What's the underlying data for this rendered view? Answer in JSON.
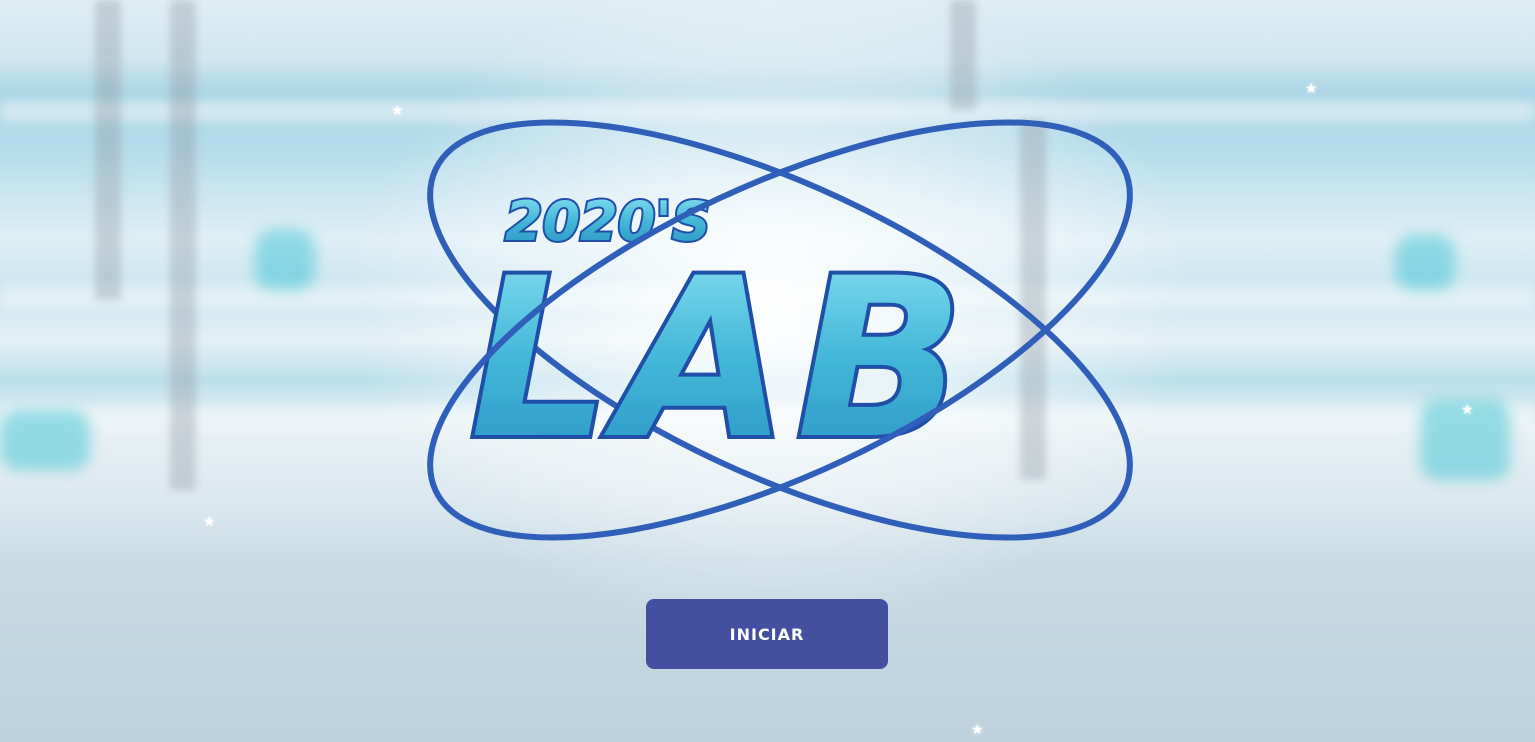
{
  "logo": {
    "top_text": "2020'S",
    "main_text": "LAB"
  },
  "start_button": {
    "label": "INICIAR"
  },
  "colors": {
    "button_bg": "#4350a0",
    "orbit": "#2f5fb8",
    "logo_fill": "#4ec3df"
  }
}
